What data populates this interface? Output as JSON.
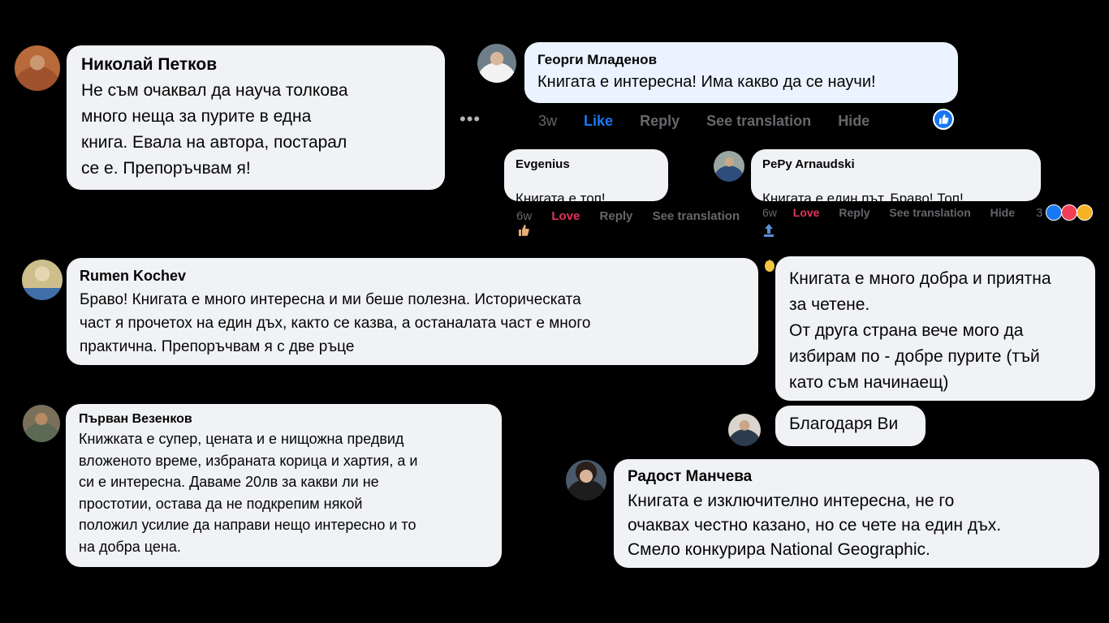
{
  "comments": {
    "nikolay": {
      "name": "Николай Петков",
      "text": "Не съм очаквал да науча толкова\nмного неща за пурите в една\nкнига. Евала на автора, постарал\nсе е. Препоръчвам я!"
    },
    "georgi": {
      "name": "Георги Младенов",
      "text": "Книгата е интересна! Има какво да се научи!",
      "time": "3w",
      "like": "Like",
      "reply": "Reply",
      "translate": "See translation",
      "hide": "Hide"
    },
    "evgenius": {
      "name": "Evgenius",
      "text": "Книгата е топ!",
      "time": "6w",
      "love": "Love",
      "reply": "Reply",
      "translate": "See translation"
    },
    "pepy": {
      "name": "PePy Arnaudski",
      "text": "Книгата е един път. Браво! Топ!",
      "time": "6w",
      "love": "Love",
      "reply": "Reply",
      "translate": "See translation",
      "hide": "Hide",
      "reaction_count": "3"
    },
    "rumen": {
      "name": "Rumen Kochev",
      "text": "Браво! Книгата е много интересна и ми беше полезна. Историческата\nчаст я прочетох на един дъх, както се казва, а останалата част е много\nпрактична. Препоръчвам я с две ръце"
    },
    "parvan": {
      "name": "Първан Везенков",
      "text": "Книжката е супер, цената и е нищожна предвид\nвложеното време, избраната корица и хартия, а и\nси е интересна. Даваме 20лв за какви ли не\nпростотии, остава да не подкрепим някой\nположил усилие да направи нещо интересно и то\nна добра цена."
    },
    "reader_message": {
      "text": "Книгата е много добра и приятна\nза четене.\nОт друга страна вече мого да\nизбирам по - добре пурите (тъй\nкато съм начинаещ)"
    },
    "author_reply": {
      "text": "Благодаря Ви"
    },
    "radost": {
      "name": "Радост Манчева",
      "text": "Книгата е изключително интересна, не го\nочаквах честно казано, но се чете на един дъх.\nСмело конкурира National Geographic."
    }
  },
  "more_options_label": "•••",
  "colors": {
    "like": "#1877f2",
    "love": "#e4345a",
    "meta": "#65676b",
    "bubble": "#f0f2f5"
  }
}
